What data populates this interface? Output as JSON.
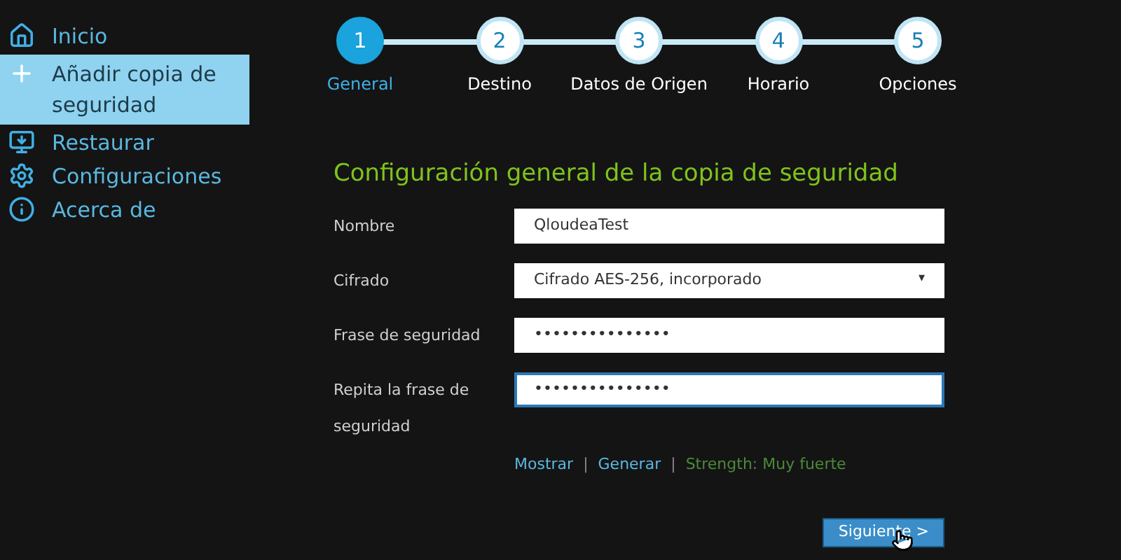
{
  "sidebar": {
    "items": [
      {
        "label": "Inicio",
        "selected": false
      },
      {
        "label": "Añadir copia de seguridad",
        "selected": true
      },
      {
        "label": "Restaurar",
        "selected": false
      },
      {
        "label": "Configuraciones",
        "selected": false
      },
      {
        "label": "Acerca de",
        "selected": false
      }
    ]
  },
  "steps": [
    {
      "number": "1",
      "label": "General",
      "selected": true
    },
    {
      "number": "2",
      "label": "Destino",
      "selected": false
    },
    {
      "number": "3",
      "label": "Datos de Origen",
      "selected": false
    },
    {
      "number": "4",
      "label": "Horario",
      "selected": false
    },
    {
      "number": "5",
      "label": "Opciones",
      "selected": false
    }
  ],
  "form": {
    "title": "Configuración general de la copia de seguridad",
    "fields": [
      {
        "label": "Nombre",
        "kind": "text",
        "value": "QloudeaTest",
        "focused": false
      },
      {
        "label": "Cifrado",
        "kind": "select",
        "value": "Cifrado AES-256, incorporado",
        "arrow": "▾",
        "focused": false
      },
      {
        "label": "Frase de seguridad",
        "kind": "password",
        "value": "•••••••••••••••",
        "focused": false
      },
      {
        "label": "Repita la frase de seguridad",
        "kind": "password",
        "value": "•••••••••••••••",
        "focused": true
      }
    ],
    "links": [
      {
        "kind": "link",
        "text": "Mostrar"
      },
      {
        "kind": "separator",
        "text": "|"
      },
      {
        "kind": "link",
        "text": "Generar"
      },
      {
        "kind": "separator",
        "text": "|"
      },
      {
        "kind": "strength",
        "text": "Strength: Muy fuerte"
      }
    ],
    "next_button": "Siguiente >"
  }
}
